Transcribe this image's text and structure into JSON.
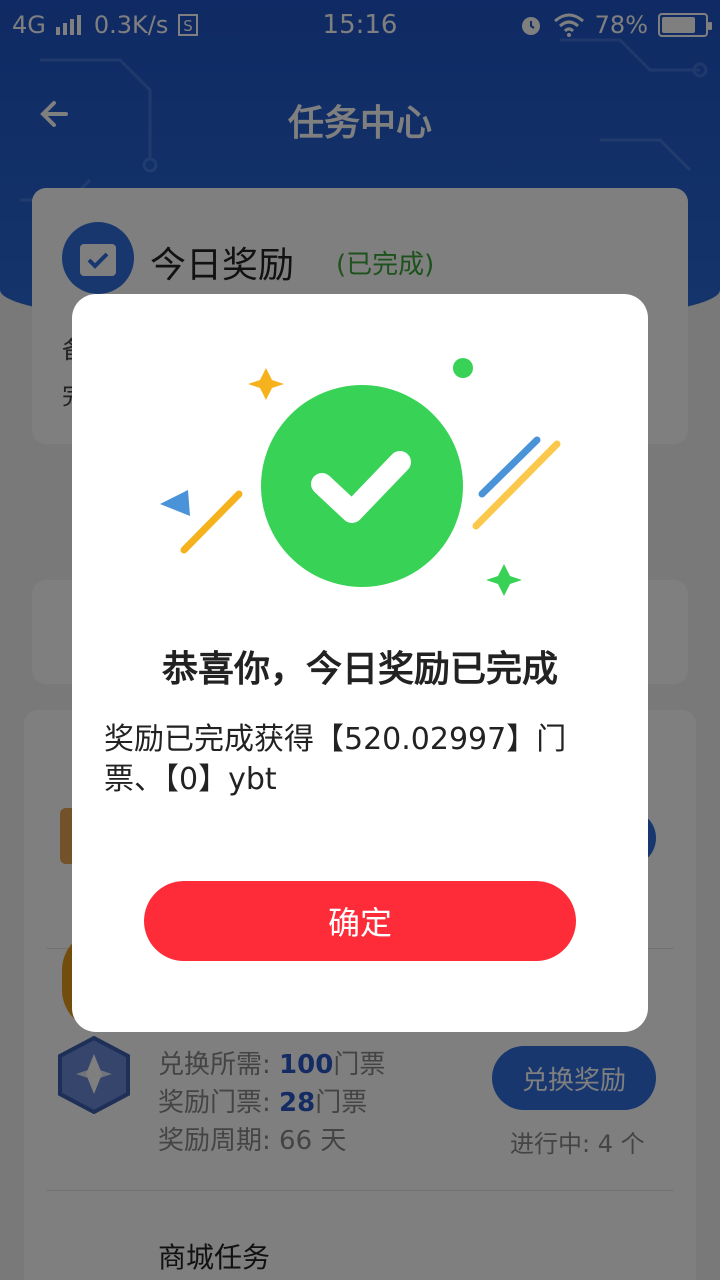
{
  "status_bar": {
    "network": "4G",
    "speed": "0.3K/s",
    "time": "15:16",
    "battery": "78%",
    "battery_level": 0.78
  },
  "nav": {
    "title": "任务中心"
  },
  "daily_card": {
    "title": "今日奖励",
    "status": "(已完成)",
    "line1_fragment": "备",
    "line2_fragment": "完"
  },
  "task_item": {
    "required_label": "兑换所需:",
    "required_value": "100",
    "required_unit": "门票",
    "reward_label": "奖励门票:",
    "reward_value": "28",
    "reward_unit": "门票",
    "period_label": "奖励周期:",
    "period_value": "66 天",
    "button": "兑换奖励",
    "progress": "进行中: 4 个"
  },
  "shop_task": {
    "title": "商城任务"
  },
  "modal": {
    "title": "恭喜你，今日奖励已完成",
    "message": "奖励已完成获得【520.02997】门票、【0】ybt",
    "confirm": "确定"
  },
  "colors": {
    "brand_blue": "#2b6ad9",
    "success_green": "#38d356",
    "confirm_red": "#fe2c38",
    "status_green": "#3aa53a"
  }
}
